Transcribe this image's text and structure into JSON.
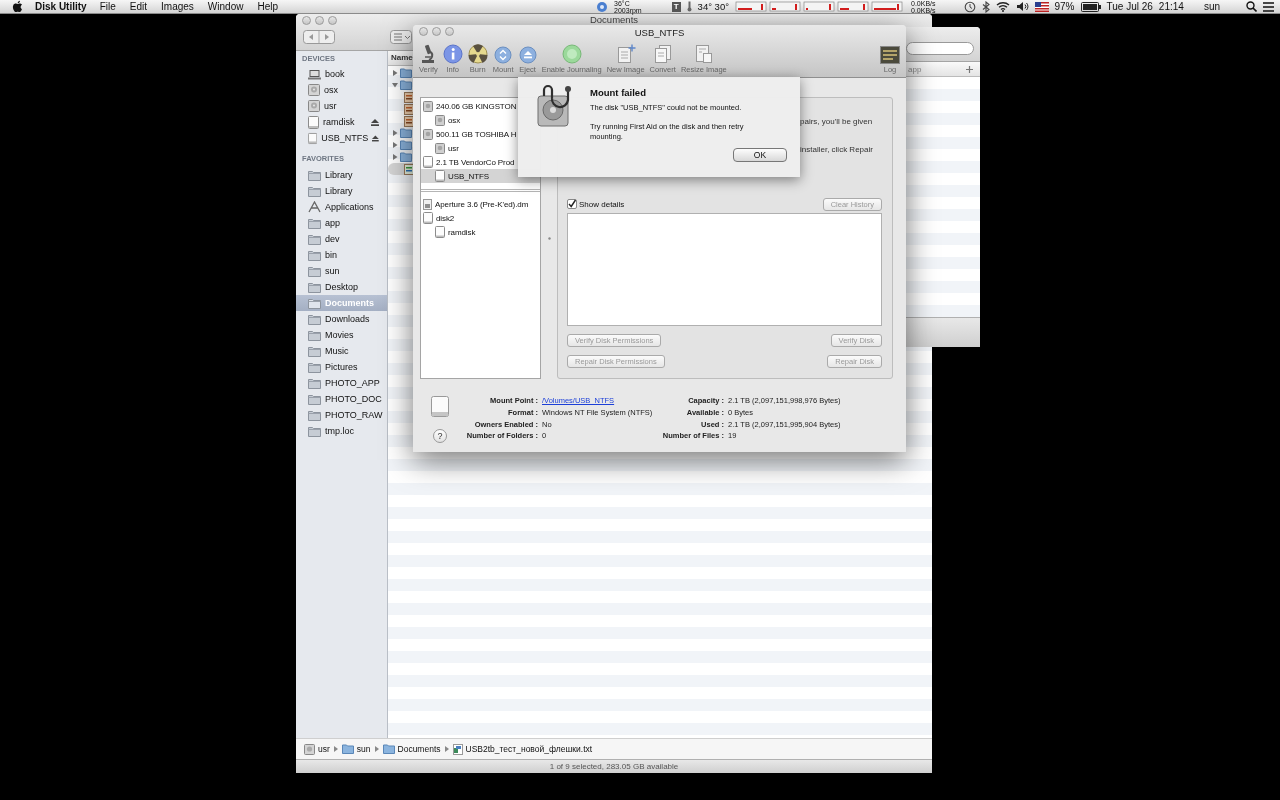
{
  "menu_bar": {
    "app_name": "Disk Utility",
    "menus": [
      "File",
      "Edit",
      "Images",
      "Window",
      "Help"
    ],
    "status": {
      "temperature": "36°C",
      "fan": "2003rpm",
      "t_label": "T",
      "temps": "34° 30°",
      "net_up": "0.0KB/s",
      "net_down": "0.0KB/s",
      "battery": "97%",
      "date": "Tue Jul 26",
      "time": "21:14",
      "user": "sun"
    }
  },
  "finder": {
    "title": "Documents",
    "column_header": "Name",
    "sidebar": [
      {
        "heading": "DEVICES",
        "items": [
          {
            "label": "book",
            "kind": "laptop",
            "eject": false,
            "selected": false
          },
          {
            "label": "osx",
            "kind": "disk",
            "eject": false,
            "selected": false
          },
          {
            "label": "usr",
            "kind": "disk",
            "eject": false,
            "selected": false
          },
          {
            "label": "ramdisk",
            "kind": "drive",
            "eject": true,
            "selected": false
          },
          {
            "label": "USB_NTFS",
            "kind": "drive",
            "eject": true,
            "selected": false
          }
        ]
      },
      {
        "heading": "FAVORITES",
        "items": [
          {
            "label": "Library",
            "kind": "folder",
            "eject": false,
            "selected": false
          },
          {
            "label": "Library",
            "kind": "folder",
            "eject": false,
            "selected": false
          },
          {
            "label": "Applications",
            "kind": "apps",
            "eject": false,
            "selected": false
          },
          {
            "label": "app",
            "kind": "folder",
            "eject": false,
            "selected": false
          },
          {
            "label": "dev",
            "kind": "folder",
            "eject": false,
            "selected": false
          },
          {
            "label": "bin",
            "kind": "folder",
            "eject": false,
            "selected": false
          },
          {
            "label": "sun",
            "kind": "folder",
            "eject": false,
            "selected": false
          },
          {
            "label": "Desktop",
            "kind": "folder",
            "eject": false,
            "selected": false
          },
          {
            "label": "Documents",
            "kind": "folder",
            "eject": false,
            "selected": true
          },
          {
            "label": "Downloads",
            "kind": "folder",
            "eject": false,
            "selected": false
          },
          {
            "label": "Movies",
            "kind": "folder",
            "eject": false,
            "selected": false
          },
          {
            "label": "Music",
            "kind": "folder",
            "eject": false,
            "selected": false
          },
          {
            "label": "Pictures",
            "kind": "folder",
            "eject": false,
            "selected": false
          },
          {
            "label": "PHOTO_APP",
            "kind": "folder",
            "eject": false,
            "selected": false
          },
          {
            "label": "PHOTO_DOC",
            "kind": "folder",
            "eject": false,
            "selected": false
          },
          {
            "label": "PHOTO_RAW",
            "kind": "folder",
            "eject": false,
            "selected": false
          },
          {
            "label": "tmp.loc",
            "kind": "folder",
            "eject": false,
            "selected": false
          }
        ]
      }
    ],
    "rows": [
      {
        "kind": "folder",
        "expanded": false,
        "selected": false
      },
      {
        "kind": "folder",
        "expanded": true,
        "selected": false
      },
      {
        "kind": "file",
        "selected": false
      },
      {
        "kind": "file",
        "selected": false
      },
      {
        "kind": "file",
        "selected": false
      },
      {
        "kind": "folder",
        "expanded": false,
        "selected": false
      },
      {
        "kind": "folder",
        "expanded": false,
        "selected": false
      },
      {
        "kind": "folder",
        "expanded": false,
        "selected": false
      },
      {
        "kind": "file",
        "selected": true
      }
    ],
    "path": [
      {
        "label": "usr",
        "kind": "disk"
      },
      {
        "label": "sun",
        "kind": "folder"
      },
      {
        "label": "Documents",
        "kind": "folder"
      },
      {
        "label": "USB2tb_тест_новой_флешки.txt",
        "kind": "file"
      }
    ],
    "status": "1 of 9 selected, 283.05 GB available"
  },
  "back_window": {
    "column_header": "app"
  },
  "disk_utility": {
    "title": "USB_NTFS",
    "toolbar": [
      {
        "label": "Verify",
        "kind": "microscope"
      },
      {
        "label": "Info",
        "kind": "info"
      },
      {
        "label": "Burn",
        "kind": "burn"
      },
      {
        "label": "Mount",
        "kind": "mount"
      },
      {
        "label": "Eject",
        "kind": "eject"
      },
      {
        "label": "Enable Journaling",
        "kind": "journal"
      },
      {
        "label": "New Image",
        "kind": "new_image"
      },
      {
        "label": "Convert",
        "kind": "convert"
      },
      {
        "label": "Resize Image",
        "kind": "resize"
      },
      {
        "label": "Log",
        "kind": "log"
      }
    ],
    "disk_list": {
      "drives": [
        {
          "label": "240.06 GB KINGSTON",
          "kind": "internal",
          "selected": false,
          "children": [
            {
              "label": "osx",
              "kind": "internal",
              "selected": false
            }
          ]
        },
        {
          "label": "500.11 GB TOSHIBA H",
          "kind": "internal",
          "selected": false,
          "children": [
            {
              "label": "usr",
              "kind": "internal",
              "selected": false
            }
          ]
        },
        {
          "label": "2.1 TB VendorCo Prod",
          "kind": "external",
          "selected": false,
          "children": [
            {
              "label": "USB_NTFS",
              "kind": "external",
              "selected": true
            }
          ]
        }
      ],
      "images": [
        {
          "label": "Aperture 3.6 (Pre-K'ed).dm",
          "kind": "image",
          "selected": false
        },
        {
          "label": "disk2",
          "kind": "external",
          "selected": false,
          "children": [
            {
              "label": "ramdisk",
              "kind": "external",
              "selected": false
            }
          ]
        }
      ]
    },
    "fragments": [
      "pairs, you'll be given",
      "installer, click Repair"
    ],
    "show_details": {
      "label": "Show details",
      "checked": true
    },
    "clear_history": {
      "label": "Clear History",
      "disabled": true
    },
    "buttons": [
      {
        "label": "Verify Disk Permissions",
        "disabled": true
      },
      {
        "label": "Verify Disk",
        "disabled": true
      },
      {
        "label": "Repair Disk Permissions",
        "disabled": true
      },
      {
        "label": "Repair Disk",
        "disabled": true
      }
    ],
    "info": {
      "left": [
        {
          "label": "Mount Point :",
          "value": "/Volumes/USB_NTFS",
          "link": true
        },
        {
          "label": "Format :",
          "value": "Windows NT File System (NTFS)",
          "link": false
        },
        {
          "label": "Owners Enabled :",
          "value": "No",
          "link": false
        },
        {
          "label": "Number of Folders :",
          "value": "0",
          "link": false
        }
      ],
      "right": [
        {
          "label": "Capacity :",
          "value": "2.1 TB (2,097,151,998,976 Bytes)"
        },
        {
          "label": "Available :",
          "value": "0 Bytes"
        },
        {
          "label": "Used :",
          "value": "2.1 TB (2,097,151,995,904 Bytes)"
        },
        {
          "label": "Number of Files :",
          "value": "19"
        }
      ]
    },
    "help": "?",
    "alert": {
      "title": "Mount failed",
      "message": "The disk \"USB_NTFS\" could not be mounted.",
      "detail": "Try running First Aid on the disk and then retry mounting.",
      "button": "OK"
    }
  }
}
